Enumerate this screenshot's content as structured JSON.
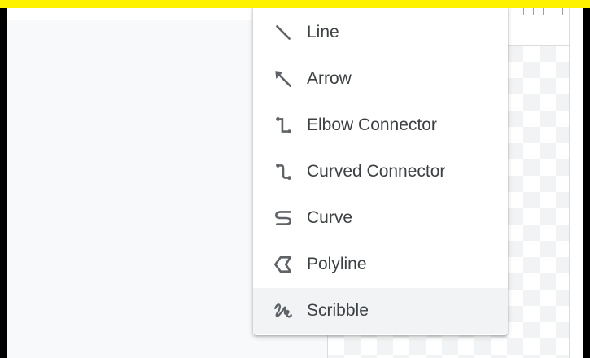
{
  "colors": {
    "banner": "#fef200",
    "menu_text": "#3c4043",
    "icon": "#5f6368",
    "hover_row": "#f1f3f4"
  },
  "line_menu": {
    "items": [
      {
        "label": "Line",
        "icon": "line-icon"
      },
      {
        "label": "Arrow",
        "icon": "arrow-icon"
      },
      {
        "label": "Elbow Connector",
        "icon": "elbow-connector-icon"
      },
      {
        "label": "Curved Connector",
        "icon": "curved-connector-icon"
      },
      {
        "label": "Curve",
        "icon": "curve-icon"
      },
      {
        "label": "Polyline",
        "icon": "polyline-icon"
      },
      {
        "label": "Scribble",
        "icon": "scribble-icon"
      }
    ],
    "highlighted_item": "Scribble"
  }
}
